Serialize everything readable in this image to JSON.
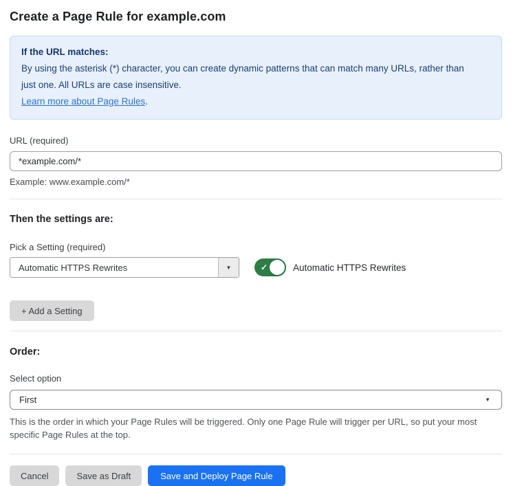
{
  "page": {
    "title": "Create a Page Rule for example.com"
  },
  "info_box": {
    "heading": "If the URL matches:",
    "body": "By using the asterisk (*) character, you can create dynamic patterns that can match many URLs, rather than just one. All URLs are case insensitive.",
    "link_text": "Learn more about Page Rules",
    "link_suffix": "."
  },
  "url_field": {
    "label": "URL (required)",
    "value": "*example.com/*",
    "example": "Example: www.example.com/*"
  },
  "settings_section": {
    "heading": "Then the settings are:",
    "picker_label": "Pick a Setting (required)",
    "selected_setting": "Automatic HTTPS Rewrites",
    "toggle_label": "Automatic HTTPS Rewrites",
    "toggle_state": "on",
    "add_setting_button": "+ Add a Setting"
  },
  "order_section": {
    "heading": "Order:",
    "select_label": "Select option",
    "selected_option": "First",
    "help_text": "This is the order in which your Page Rules will be triggered. Only one Page Rule will trigger per URL, so put your most specific Page Rules at the top."
  },
  "footer": {
    "cancel_label": "Cancel",
    "save_draft_label": "Save as Draft",
    "save_deploy_label": "Save and Deploy Page Rule"
  },
  "icons": {
    "dropdown_arrow": "▼",
    "check": "✓"
  },
  "colors": {
    "info_bg": "#e7f0fb",
    "info_border": "#c3d9f1",
    "info_heading_text": "#16356b",
    "info_body_text": "#1e3e72",
    "link": "#2e72d2",
    "toggle_on_green": "#2d7d46",
    "primary_button_blue": "#1a71f2",
    "secondary_button_gray": "#d8d8d8"
  }
}
